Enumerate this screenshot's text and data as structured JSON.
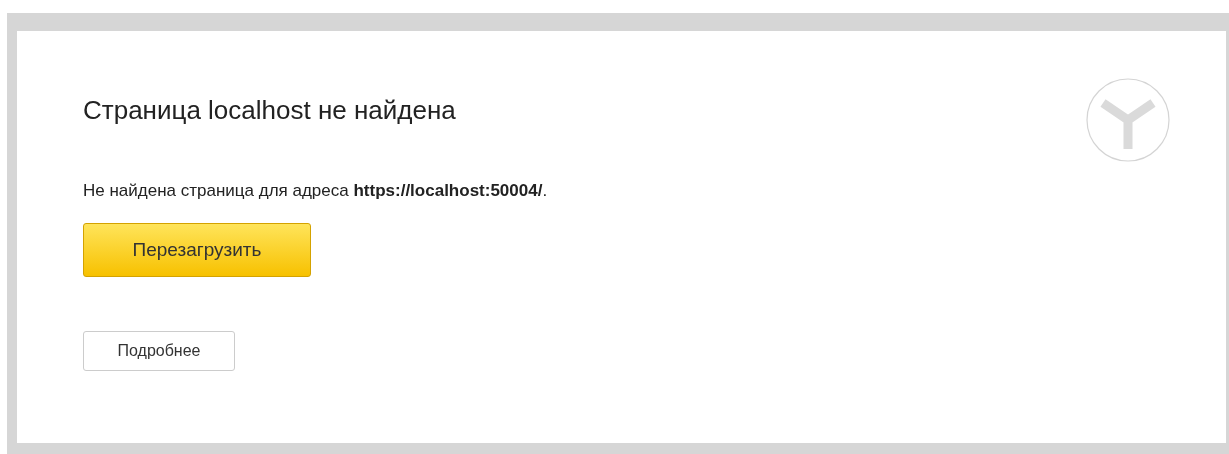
{
  "title": "Страница localhost не найдена",
  "message": "Не найдена страница для адреса **https://localhost:50004/**.",
  "buttons": [
    {
      "kind": "primary",
      "label": "Перезагрузить"
    },
    {
      "kind": "secondary",
      "label": "Подробнее"
    }
  ]
}
